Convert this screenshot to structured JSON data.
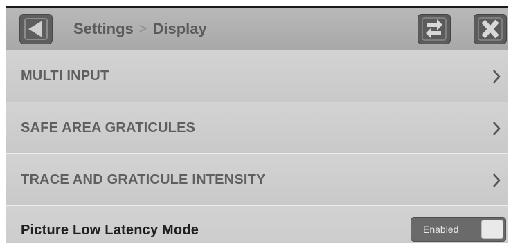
{
  "header": {
    "breadcrumb_parent": "Settings",
    "breadcrumb_separator": ">",
    "breadcrumb_current": "Display"
  },
  "menu": {
    "items": [
      {
        "label": "MULTI INPUT",
        "icon": "chevron-right-icon"
      },
      {
        "label": "SAFE AREA GRATICULES",
        "icon": "chevron-right-icon"
      },
      {
        "label": "TRACE AND GRATICULE INTENSITY",
        "icon": "chevron-right-icon"
      }
    ],
    "toggle_item": {
      "label": "Picture Low Latency Mode",
      "state": "Enabled"
    }
  },
  "icons": {
    "back": "back-arrow-icon",
    "swap": "swap-arrows-icon",
    "close": "close-x-icon"
  },
  "colors": {
    "header_bg": "#b0b0b0",
    "row_bg": "#cfcfcf",
    "button_bg": "#5b5b5b",
    "toggle_bg": "#6a6a6a"
  }
}
